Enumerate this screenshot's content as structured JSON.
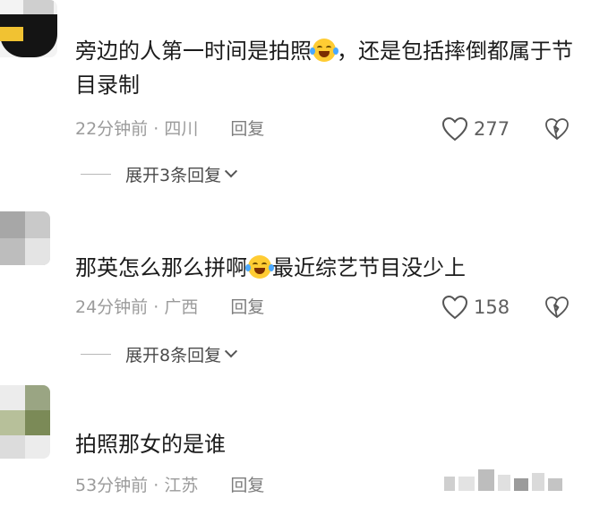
{
  "comments": [
    {
      "text_before_emoji": "旁边的人第一时间是拍照",
      "text_after_emoji": "，还是包括摔倒都属于节目录制",
      "time": "22分钟前",
      "location": "四川",
      "reply_label": "回复",
      "likes": "277",
      "expand_label": "展开3条回复"
    },
    {
      "text_before_emoji": "那英怎么那么拼啊",
      "text_after_emoji": "最近综艺节目没少上",
      "time": "24分钟前",
      "location": "广西",
      "reply_label": "回复",
      "likes": "158",
      "expand_label": "展开8条回复"
    },
    {
      "text": "拍照那女的是谁",
      "time": "53分钟前",
      "location": "江苏",
      "reply_label": "回复"
    }
  ],
  "meta_separator": " · ",
  "icons": {
    "like": "heart-outline-icon",
    "dislike": "broken-heart-icon",
    "emoji": "laughing-tears-emoji-icon"
  },
  "colors": {
    "text": "#1c1c1c",
    "meta": "#9b9b9b",
    "like_icon": "#555555"
  }
}
